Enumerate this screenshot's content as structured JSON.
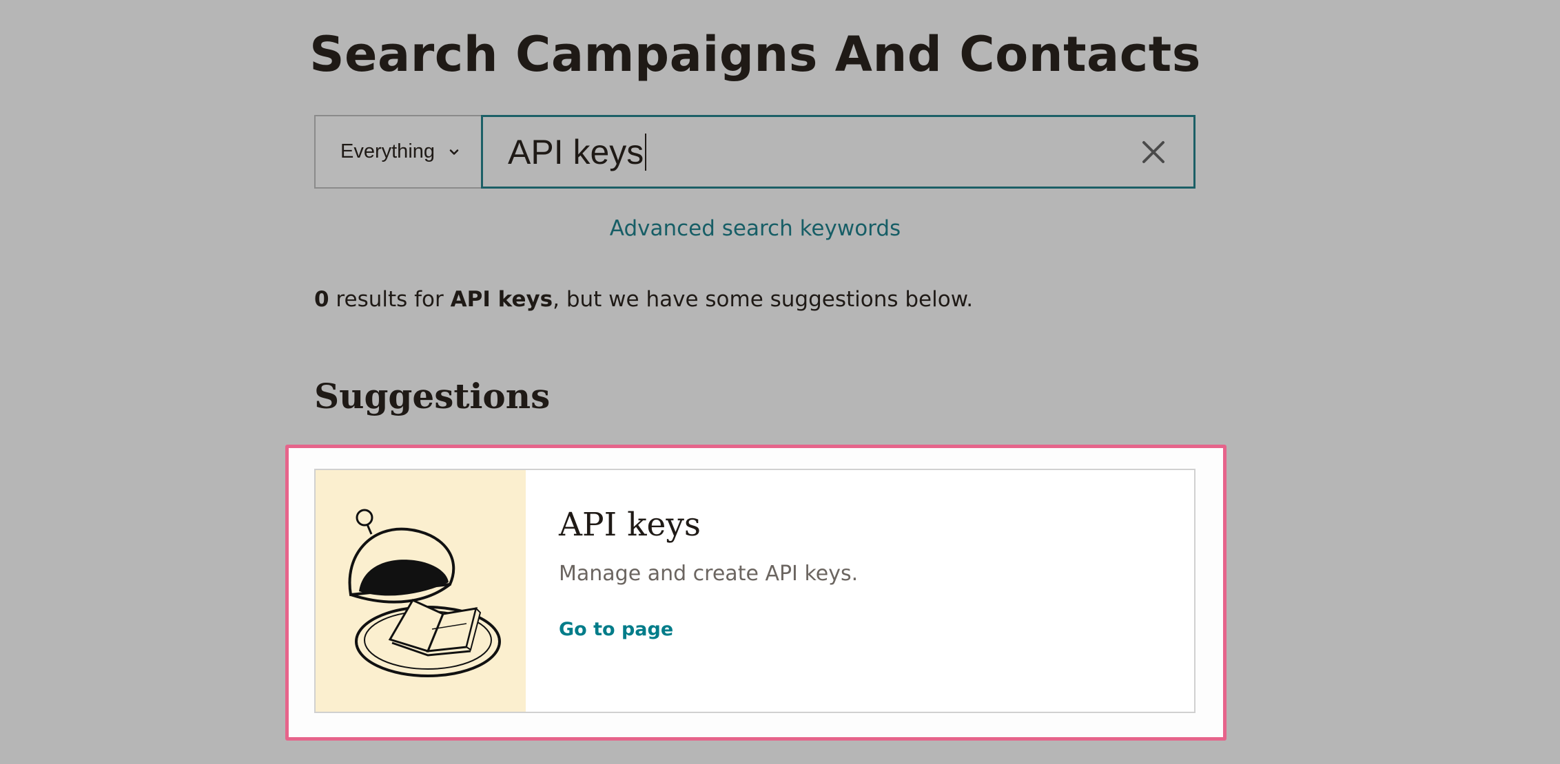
{
  "page": {
    "title": "Search Campaigns And Contacts"
  },
  "search": {
    "scope_label": "Everything",
    "query": "API keys",
    "clear_icon": "close-icon",
    "scope_icon": "chevron-down-icon"
  },
  "advanced_link": "Advanced search keywords",
  "results": {
    "count": "0",
    "prefix": " results for ",
    "query": "API keys",
    "suffix": ", but we have some suggestions below."
  },
  "suggestions": {
    "heading": "Suggestions",
    "items": [
      {
        "title": "API keys",
        "description": "Manage and create API keys.",
        "link": "Go to page",
        "illustration": "cloche-book-illustration"
      }
    ]
  },
  "colors": {
    "background": "#b6b6b6",
    "link": "#175e66",
    "accent_link": "#007c89",
    "highlight": "#e6648b",
    "illustration_bg": "#fbefcf"
  }
}
